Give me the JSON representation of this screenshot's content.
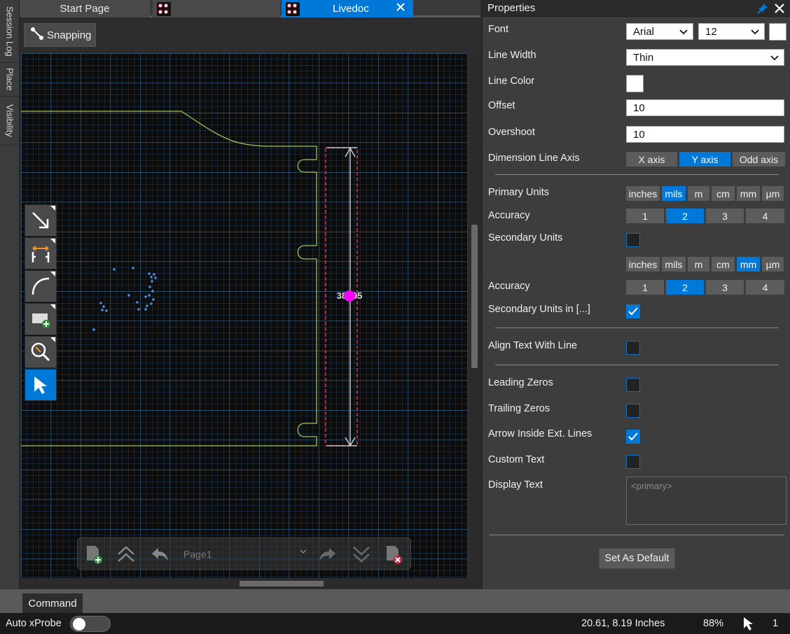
{
  "side_tabs": [
    "Session Log",
    "Place",
    "Visibility"
  ],
  "doc_tabs": [
    {
      "label": "Start Page"
    },
    {
      "label": ""
    },
    {
      "label": "Livedoc",
      "active": true
    }
  ],
  "toolbar": {
    "snapping_label": "Snapping"
  },
  "canvas": {
    "dimension_value": "38.95",
    "dimension_value_display": "38●95"
  },
  "page_nav": {
    "page_name": "Page1"
  },
  "properties": {
    "title": "Properties",
    "font_label": "Font",
    "font_family": "Arial",
    "font_size": "12",
    "line_width_label": "Line Width",
    "line_width": "Thin",
    "line_color_label": "Line Color",
    "offset_label": "Offset",
    "offset": "10",
    "overshoot_label": "Overshoot",
    "overshoot": "10",
    "axis_label": "Dimension Line Axis",
    "axis_options": [
      "X axis",
      "Y axis",
      "Odd axis"
    ],
    "axis_selected": "Y axis",
    "primary_units_label": "Primary Units",
    "units": [
      "inches",
      "mils",
      "m",
      "cm",
      "mm",
      "µm"
    ],
    "primary_units_selected": "mils",
    "accuracy_label": "Accuracy",
    "accuracy_options": [
      "1",
      "2",
      "3",
      "4"
    ],
    "primary_accuracy_selected": "2",
    "secondary_units_label": "Secondary Units",
    "secondary_units_checked": false,
    "secondary_units_selected": "mm",
    "secondary_accuracy_label": "Accuracy",
    "secondary_accuracy_selected": "2",
    "secondary_in_label": "Secondary Units in [...]",
    "secondary_in_checked": true,
    "align_text_label": "Align Text With Line",
    "align_text_checked": false,
    "leading_zeros_label": "Leading Zeros",
    "leading_zeros_checked": false,
    "trailing_zeros_label": "Trailing Zeros",
    "trailing_zeros_checked": false,
    "arrow_inside_label": "Arrow Inside Ext. Lines",
    "arrow_inside_checked": true,
    "custom_text_label": "Custom Text",
    "custom_text_checked": false,
    "display_text_label": "Display Text",
    "display_text_placeholder": "<primary>",
    "set_default_label": "Set As Default"
  },
  "command_tab": "Command",
  "status": {
    "auto_xprobe_label": "Auto xProbe",
    "auto_xprobe_on": false,
    "coordinates": "20.61, 8.19 Inches",
    "zoom": "88%",
    "selection_count": "1"
  },
  "colors": {
    "accent": "#0078d7",
    "grid_major": "#2e5f8a",
    "board_outline": "#9bc45a",
    "dimension_box": "#d23a4a",
    "dimension_dot": "#ff00ff",
    "points": "#4a90e2"
  }
}
